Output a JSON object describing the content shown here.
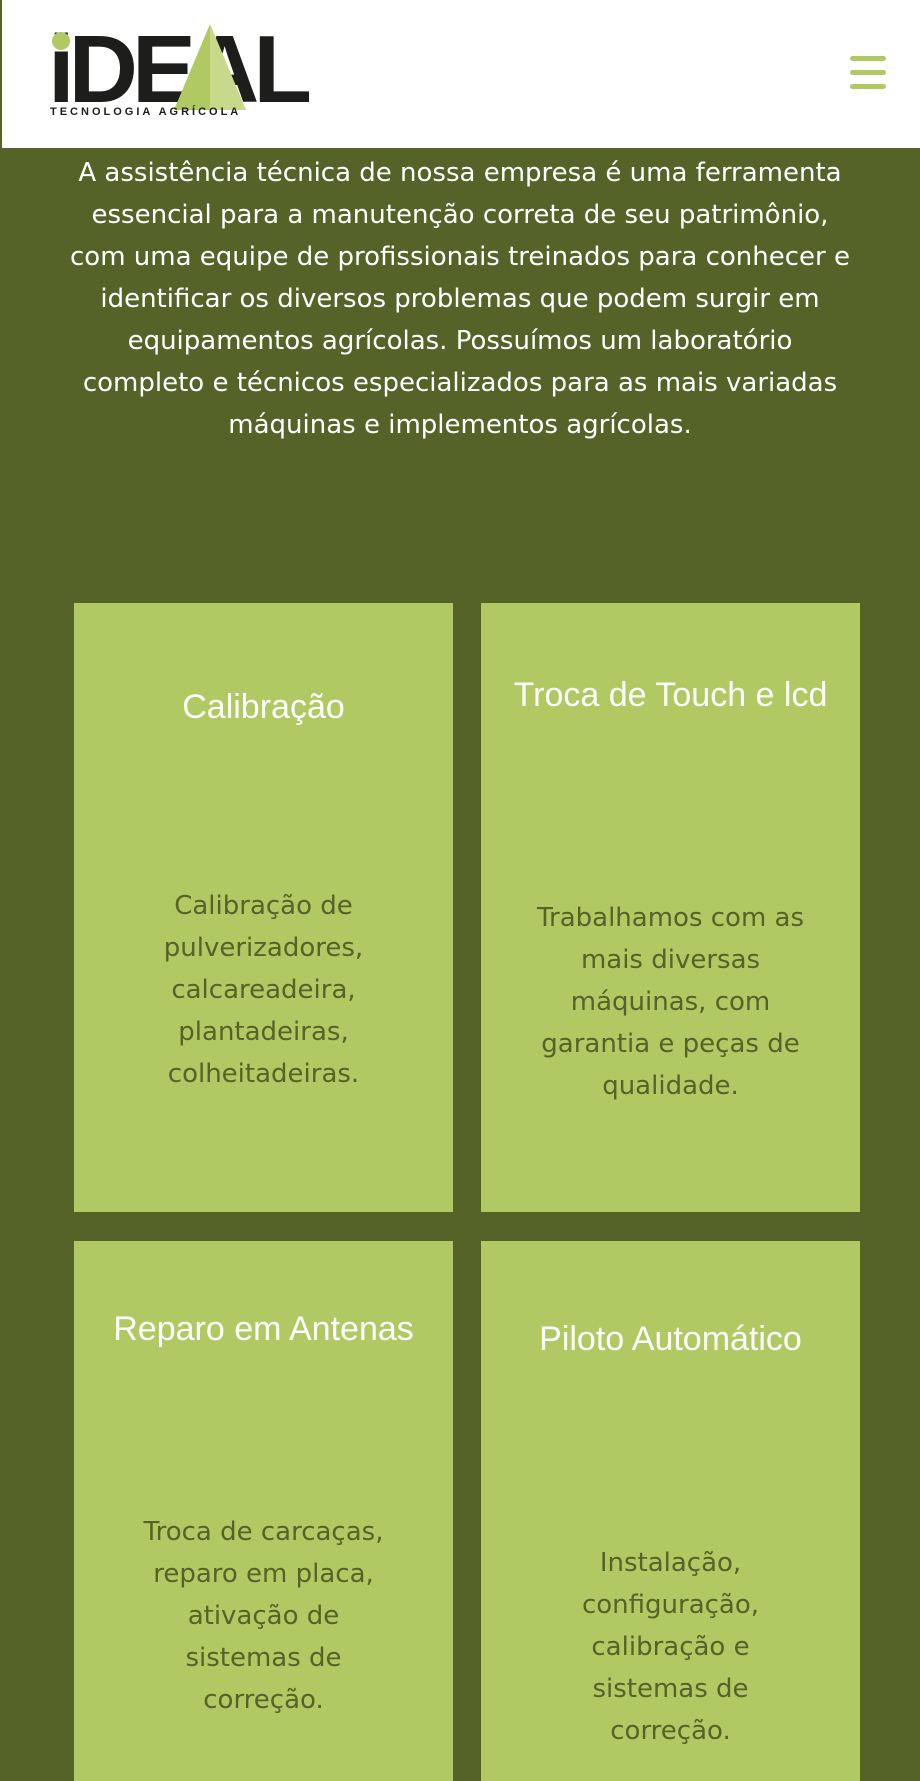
{
  "brand": {
    "logo_text": "iDEAL",
    "tagline": "TECNOLOGIA AGRÍCOLA",
    "accent_color": "#b1c962",
    "background_color": "#556329"
  },
  "header": {
    "menu_icon": "hamburger-menu-icon"
  },
  "intro": {
    "text": "A assistência técnica de nossa empresa é uma ferramenta essencial para a manutenção correta de seu patrimônio, com uma equipe de profissionais treinados para conhecer e identificar os diversos problemas que podem surgir em equipamentos agrícolas. Possuímos um laboratório completo e técnicos especializados para as mais variadas máquinas e implementos agrícolas."
  },
  "services": [
    {
      "title": "Calibração",
      "description": "Calibração de pulverizadores, calcareadeira, plantadeiras, colheitadeiras."
    },
    {
      "title": "Troca de Touch e lcd",
      "description": "Trabalhamos com as mais diversas máquinas, com garantia e peças de qualidade."
    },
    {
      "title": "Reparo em Antenas",
      "description": "Troca de carcaças, reparo em placa, ativação de sistemas de correção."
    },
    {
      "title": "Piloto Automático",
      "description": "Instalação, configuração, calibração e sistemas de correção."
    }
  ]
}
